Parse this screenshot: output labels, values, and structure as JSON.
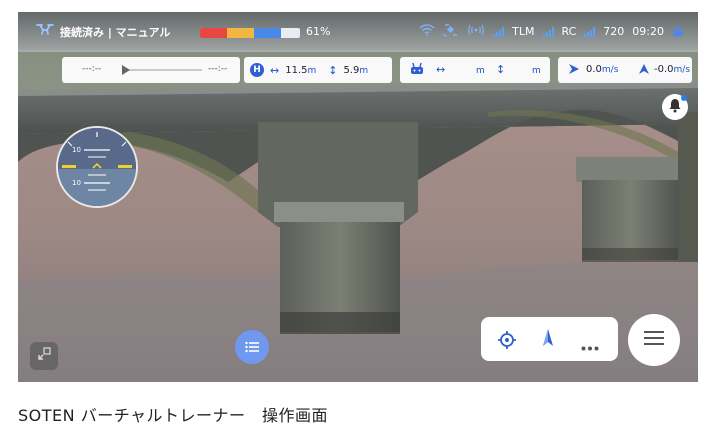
{
  "status_bar": {
    "connection_label": "接続済み | マニュアル",
    "battery_percent_label": "61%",
    "battery_level": 0.61,
    "battery_colors": [
      "#e8473f",
      "#f2b643",
      "#4a88e8"
    ],
    "telemetry_label": "TLM",
    "rc_label": "RC",
    "video_label": "720",
    "time": "09:20",
    "icons": [
      "drone-icon",
      "wifi-icon",
      "satellite-icon",
      "radio-waves-icon",
      "signal-bars-icon",
      "lock-icon"
    ]
  },
  "playback": {
    "start": "---:--",
    "end": "---:--"
  },
  "home_distance": {
    "icon_letter": "H",
    "horizontal_value": "11.5",
    "horizontal_unit": "m",
    "vertical_value": "5.9",
    "vertical_unit": "m"
  },
  "rc_distance": {
    "horizontal_value": "",
    "horizontal_unit": "m",
    "vertical_value": "",
    "vertical_unit": "m"
  },
  "speed": {
    "horizontal": "0.0",
    "horizontal_unit": "m/s",
    "vertical": "-0.0",
    "vertical_unit": "m/s"
  },
  "attitude": {
    "upper_label": "10",
    "lower_label": "10"
  },
  "accent_color": "#2f5fd0",
  "caption": "SOTEN バーチャルトレーナー　操作画面"
}
